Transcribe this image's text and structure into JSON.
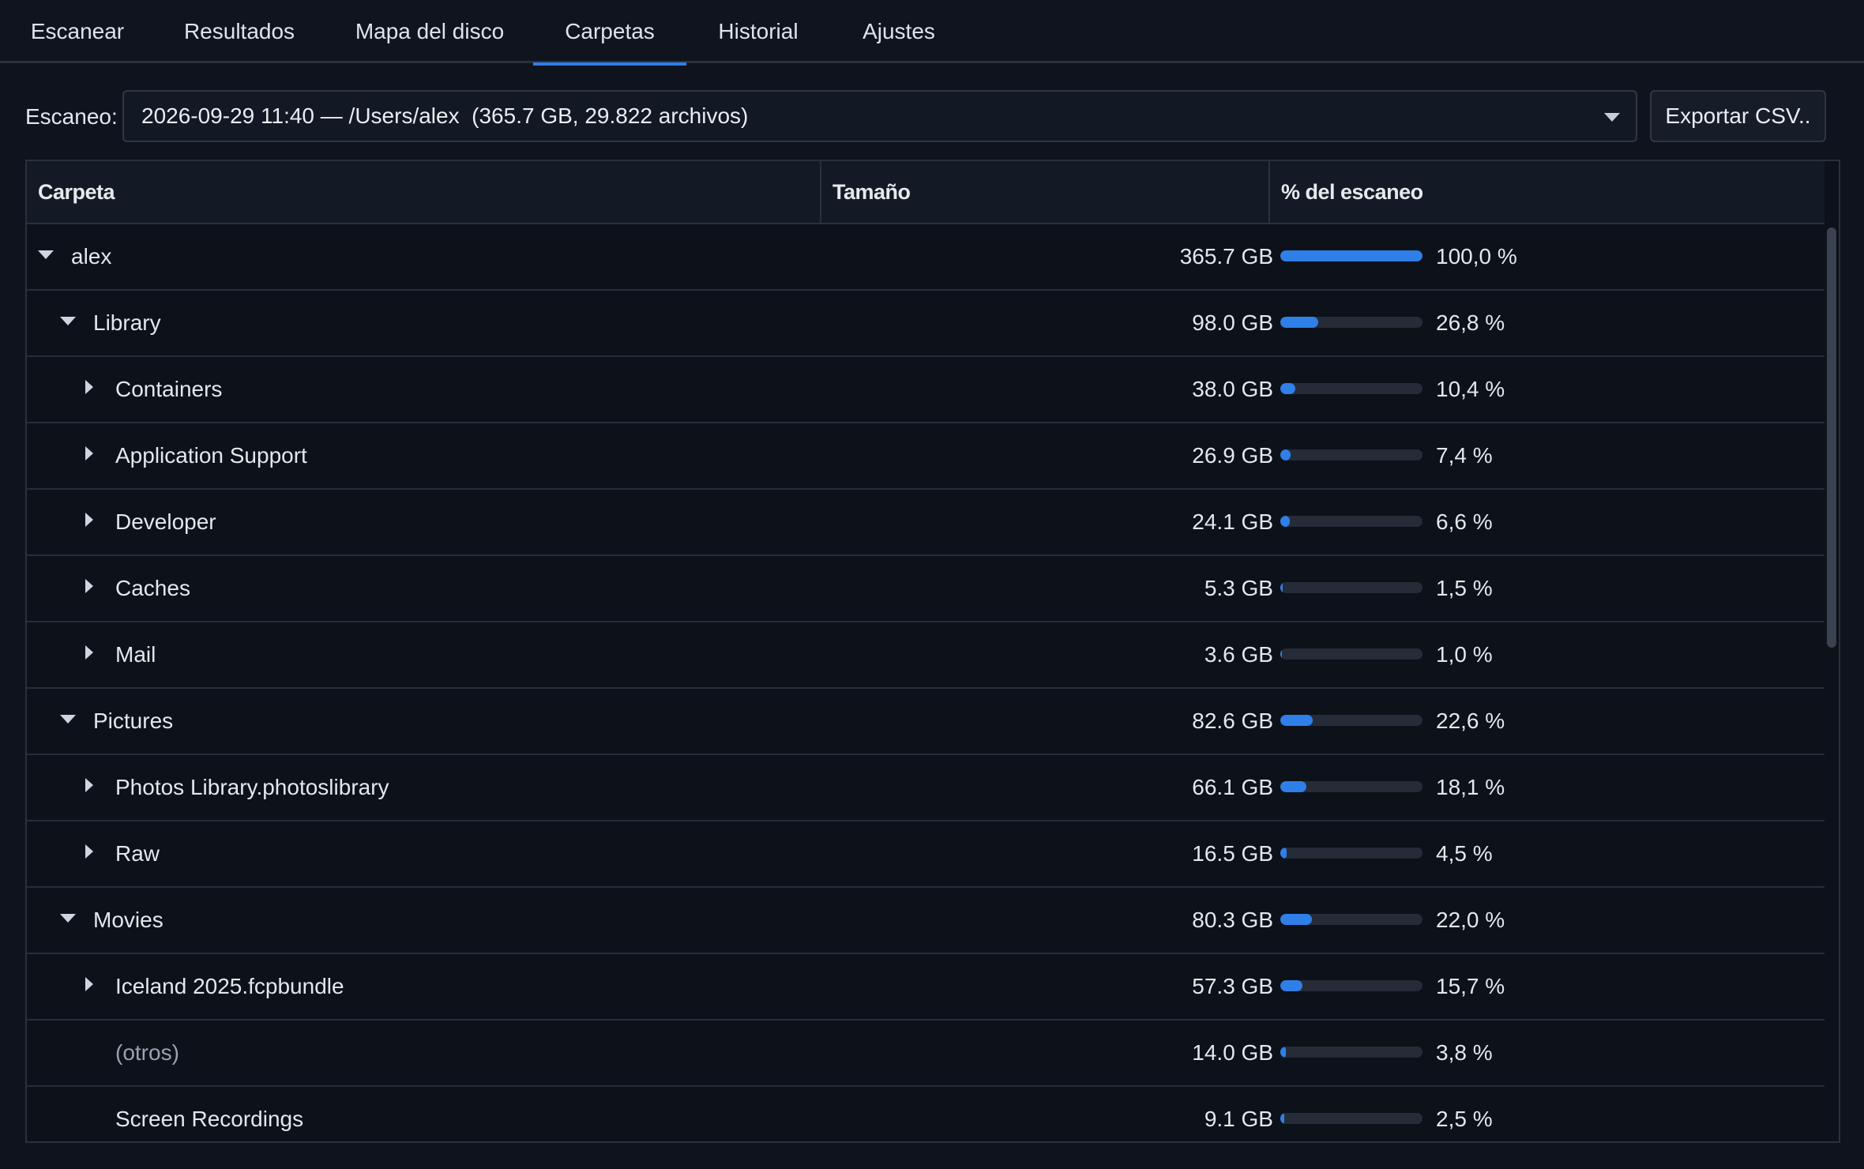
{
  "tabs": [
    {
      "label": "Escanear",
      "active": false
    },
    {
      "label": "Resultados",
      "active": false
    },
    {
      "label": "Mapa del disco",
      "active": false
    },
    {
      "label": "Carpetas",
      "active": true
    },
    {
      "label": "Historial",
      "active": false
    },
    {
      "label": "Ajustes",
      "active": false
    }
  ],
  "scan": {
    "label": "Escaneo:",
    "selected": "2026-09-29 11:40 — /Users/alex  (365.7 GB, 29.822 archivos)",
    "export_label": "Exportar CSV.."
  },
  "table": {
    "columns": [
      "Carpeta",
      "Tamaño",
      "% del escaneo"
    ],
    "rows": [
      {
        "name": "alex",
        "depth": 0,
        "toggle": "expanded",
        "size": "365.7 GB",
        "pct_label": "100,0 %",
        "pct": 100.0,
        "dim": false
      },
      {
        "name": "Library",
        "depth": 1,
        "toggle": "expanded",
        "size": "98.0 GB",
        "pct_label": "26,8 %",
        "pct": 26.8,
        "dim": false
      },
      {
        "name": "Containers",
        "depth": 2,
        "toggle": "collapsed",
        "size": "38.0 GB",
        "pct_label": "10,4 %",
        "pct": 10.4,
        "dim": false
      },
      {
        "name": "Application Support",
        "depth": 2,
        "toggle": "collapsed",
        "size": "26.9 GB",
        "pct_label": "7,4 %",
        "pct": 7.4,
        "dim": false
      },
      {
        "name": "Developer",
        "depth": 2,
        "toggle": "collapsed",
        "size": "24.1 GB",
        "pct_label": "6,6 %",
        "pct": 6.6,
        "dim": false
      },
      {
        "name": "Caches",
        "depth": 2,
        "toggle": "collapsed",
        "size": "5.3 GB",
        "pct_label": "1,5 %",
        "pct": 1.5,
        "dim": false
      },
      {
        "name": "Mail",
        "depth": 2,
        "toggle": "collapsed",
        "size": "3.6 GB",
        "pct_label": "1,0 %",
        "pct": 1.0,
        "dim": false
      },
      {
        "name": "Pictures",
        "depth": 1,
        "toggle": "expanded",
        "size": "82.6 GB",
        "pct_label": "22,6 %",
        "pct": 22.6,
        "dim": false
      },
      {
        "name": "Photos Library.photoslibrary",
        "depth": 2,
        "toggle": "collapsed",
        "size": "66.1 GB",
        "pct_label": "18,1 %",
        "pct": 18.1,
        "dim": false
      },
      {
        "name": "Raw",
        "depth": 2,
        "toggle": "collapsed",
        "size": "16.5 GB",
        "pct_label": "4,5 %",
        "pct": 4.5,
        "dim": false
      },
      {
        "name": "Movies",
        "depth": 1,
        "toggle": "expanded",
        "size": "80.3 GB",
        "pct_label": "22,0 %",
        "pct": 22.0,
        "dim": false
      },
      {
        "name": "Iceland 2025.fcpbundle",
        "depth": 2,
        "toggle": "collapsed",
        "size": "57.3 GB",
        "pct_label": "15,7 %",
        "pct": 15.7,
        "dim": false
      },
      {
        "name": "(otros)",
        "depth": 2,
        "toggle": "none",
        "size": "14.0 GB",
        "pct_label": "3,8 %",
        "pct": 3.8,
        "dim": true
      },
      {
        "name": "Screen Recordings",
        "depth": 2,
        "toggle": "none",
        "size": "9.1 GB",
        "pct_label": "2,5 %",
        "pct": 2.5,
        "dim": false
      }
    ]
  },
  "colors": {
    "accent": "#2f7fe8",
    "background": "#0e131d",
    "track": "#252c38"
  }
}
